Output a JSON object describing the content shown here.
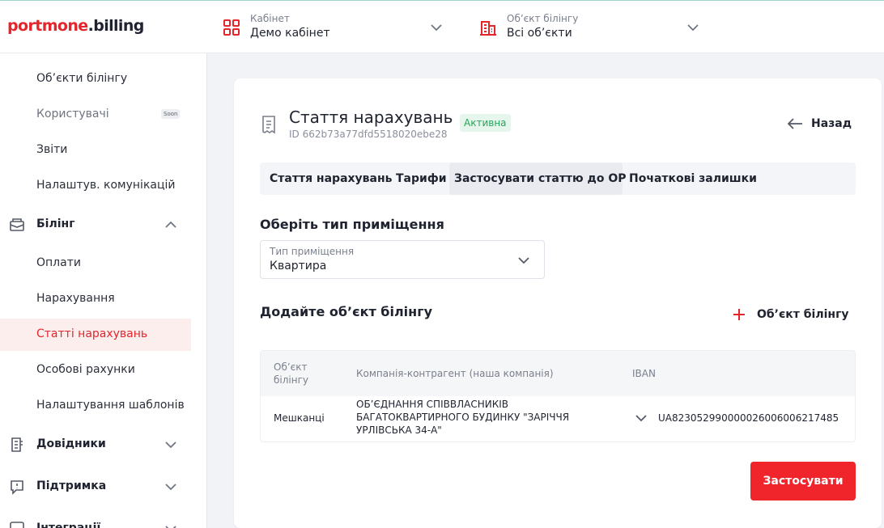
{
  "logo": {
    "part1": "portmone",
    "part2": ".billing"
  },
  "header": {
    "cabinet": {
      "label": "Кабінет",
      "value": "Демо кабінет"
    },
    "billing_object": {
      "label": "Об’єкт білінгу",
      "value": "Всі об’єкти"
    }
  },
  "sidebar": {
    "items": [
      {
        "label": "Об’єкти білінгу"
      },
      {
        "label": "Користувачі",
        "badge": "Soon"
      },
      {
        "label": "Звіти"
      },
      {
        "label": "Налаштув. комунікацій"
      },
      {
        "label": "Білінг"
      },
      {
        "label": "Оплати"
      },
      {
        "label": "Нарахування"
      },
      {
        "label": "Статті нарахувань"
      },
      {
        "label": "Особові рахунки"
      },
      {
        "label": "Налаштування шаблонів"
      },
      {
        "label": "Довідники"
      },
      {
        "label": "Підтримка"
      },
      {
        "label": "Інтеграції"
      }
    ]
  },
  "page": {
    "title": "Стаття нарахувань",
    "id_text": "ID 662b73a77dfd5518020ebe28",
    "status": "Активна",
    "back_label": "Назад"
  },
  "tabs": [
    {
      "label": "Стаття нарахувань"
    },
    {
      "label": "Тарифи"
    },
    {
      "label": "Застосувати статтю до ОР"
    },
    {
      "label": "Початкові залишки"
    }
  ],
  "premise": {
    "heading": "Оберіть тип приміщення",
    "select_label": "Тип приміщення",
    "select_value": "Квартира"
  },
  "billing_objects": {
    "heading": "Додайте об’єкт білінгу",
    "add_label": "Об’єкт білінгу",
    "table": {
      "headers": {
        "object_line1": "Об’єкт",
        "object_line2": "білінгу",
        "company": "Компанія-контрагент (наша компанія)",
        "iban": "IBAN"
      },
      "rows": [
        {
          "object": "Мешканці",
          "company_line1": "ОБ’ЄДНАННЯ СПІВВЛАСНИКІВ",
          "company_line2": "БАГАТОКВАРТИРНОГО БУДИНКУ \"ЗАРІЧЧЯ",
          "company_line3": "УРЛІВСЬКА 34-А\"",
          "iban": "UA823052990000026006006217485"
        }
      ]
    }
  },
  "apply_label": "Застосувати",
  "colors": {
    "accent": "#e4262c",
    "active_badge_bg": "#e6f6ec",
    "active_badge_text": "#27a55a"
  }
}
